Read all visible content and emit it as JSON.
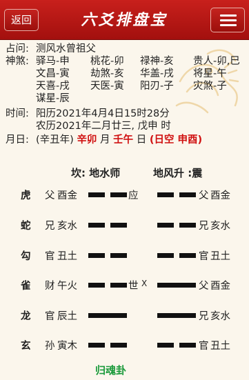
{
  "header": {
    "back_label": "返回",
    "title": "六爻排盘宝"
  },
  "info": {
    "question_label": "占问:",
    "question": "测风水曾祖父",
    "shensha_label": "神煞:",
    "shensha": [
      "驿马-申",
      "桃花-卯",
      "禄神-亥",
      "贵人-卯,巳",
      "文昌-寅",
      "劫煞-亥",
      "华盖-戌",
      "将星-午",
      "天喜-戌",
      "天医-寅",
      "阳刃-子",
      "灾煞-子",
      "谋星-辰"
    ],
    "time_label": "时间:",
    "solar": "阳历2021年4月4日15时28分",
    "lunar": "农历2021年二月廿三, 戊申 时",
    "day_label": "月日:",
    "year_gz": "(辛丑年)",
    "month_gz": "辛卯",
    "month_char": "月",
    "day_gz": "壬午",
    "day_char": "日",
    "kong": "(日空 申酉)"
  },
  "hexagram": {
    "main_name": "坎: 地水师",
    "changed_name": "地风升 :震",
    "lines": [
      {
        "beast": "虎",
        "liuqin": "父",
        "najia": "酉金",
        "mark": "应",
        "moving": "",
        "yang": false,
        "c_liuqin": "父",
        "c_najia": "酉金",
        "c_yang": false
      },
      {
        "beast": "蛇",
        "liuqin": "兄",
        "najia": "亥水",
        "mark": "",
        "moving": "",
        "yang": false,
        "c_liuqin": "兄",
        "c_najia": "亥水",
        "c_yang": false
      },
      {
        "beast": "勾",
        "liuqin": "官",
        "najia": "丑土",
        "mark": "",
        "moving": "",
        "yang": false,
        "c_liuqin": "官",
        "c_najia": "丑土",
        "c_yang": false
      },
      {
        "beast": "雀",
        "liuqin": "财",
        "najia": "午火",
        "mark": "世",
        "moving": "X",
        "yang": false,
        "c_liuqin": "父",
        "c_najia": "酉金",
        "c_yang": true
      },
      {
        "beast": "龙",
        "liuqin": "官",
        "najia": "辰土",
        "mark": "",
        "moving": "",
        "yang": true,
        "c_liuqin": "兄",
        "c_najia": "亥水",
        "c_yang": true
      },
      {
        "beast": "玄",
        "liuqin": "孙",
        "najia": "寅木",
        "mark": "",
        "moving": "",
        "yang": false,
        "c_liuqin": "官",
        "c_najia": "丑土",
        "c_yang": false
      }
    ],
    "footer": "归魂卦"
  },
  "colors": {
    "header_red": "#b0140f",
    "accent_red": "#d01010",
    "footer_green": "#1a9a3a",
    "background": "#fbf6ec"
  },
  "icons": {
    "menu": "hamburger-menu-icon",
    "decor": "dragon-decoration"
  }
}
